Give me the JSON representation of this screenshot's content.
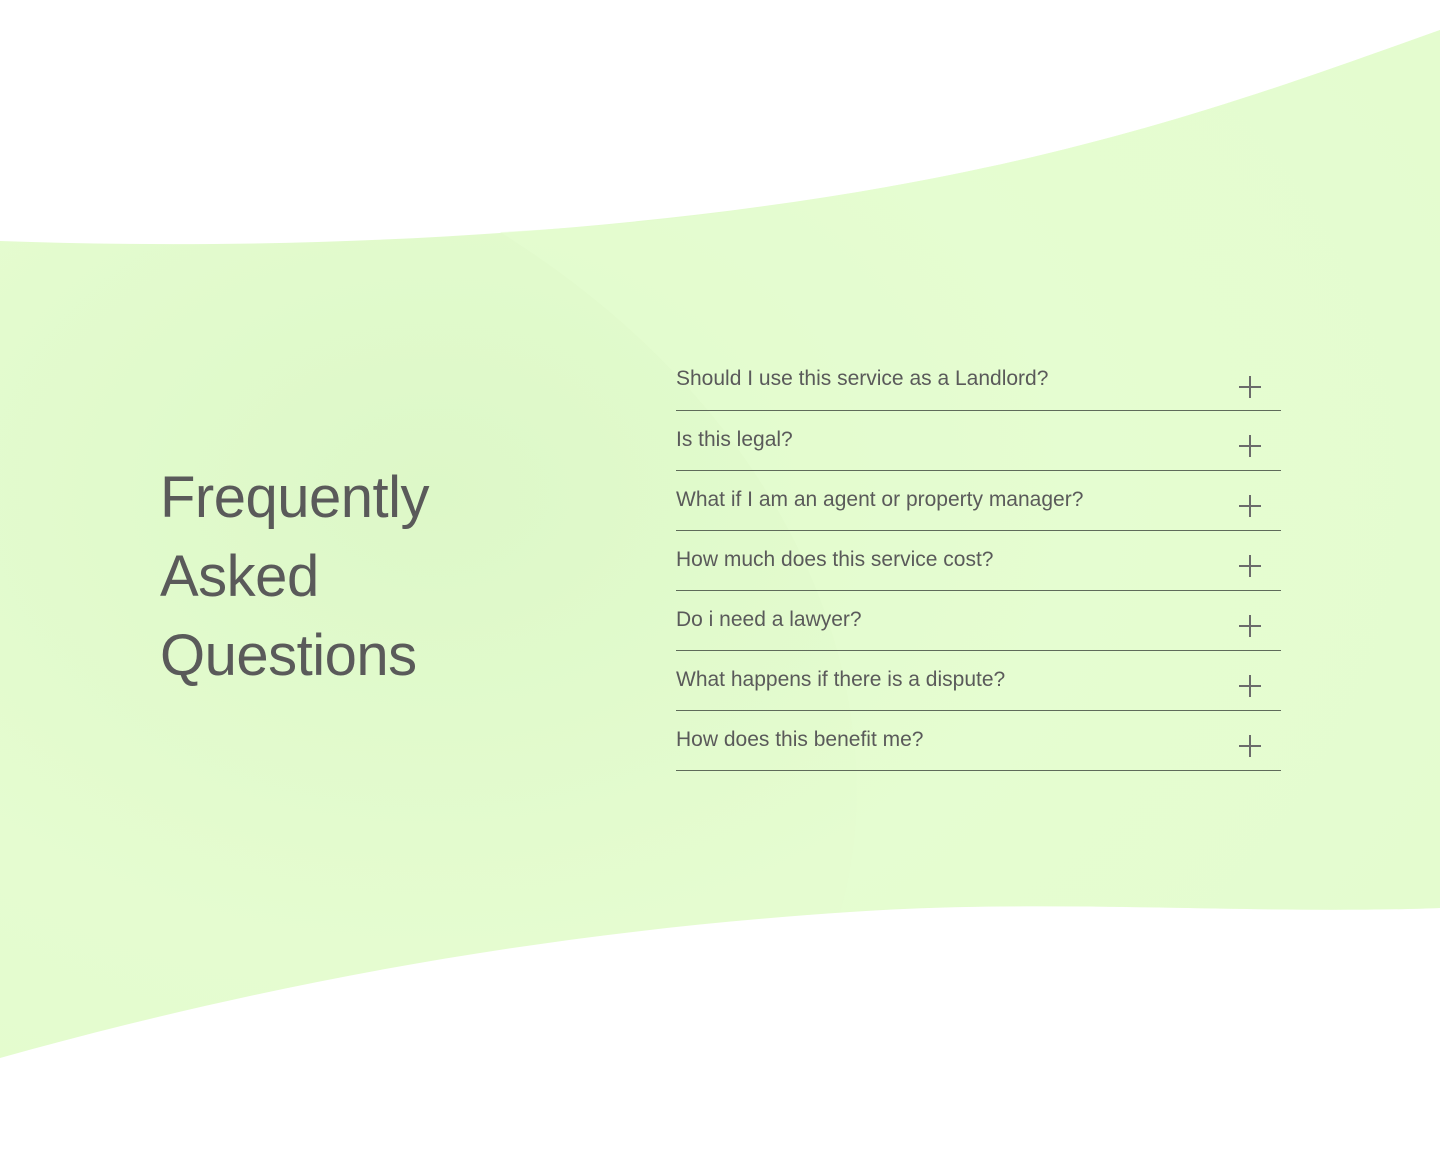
{
  "colors": {
    "background": "#ffffff",
    "wave_fill": "#e4fbcf",
    "text": "#5a5a5a",
    "divider": "#5f6b5a"
  },
  "faq": {
    "heading_lines": [
      "Frequently",
      "Asked",
      "Questions"
    ],
    "items": [
      {
        "question": "Should I use this service as a Landlord?",
        "icon": "plus-icon"
      },
      {
        "question": "Is this legal?",
        "icon": "plus-icon"
      },
      {
        "question": "What if I am an agent or property manager?",
        "icon": "plus-icon"
      },
      {
        "question": "How much does this service cost?",
        "icon": "plus-icon"
      },
      {
        "question": "Do i need a lawyer?",
        "icon": "plus-icon"
      },
      {
        "question": "What happens if there is a dispute?",
        "icon": "plus-icon"
      },
      {
        "question": "How does this benefit me?",
        "icon": "plus-icon"
      }
    ]
  }
}
